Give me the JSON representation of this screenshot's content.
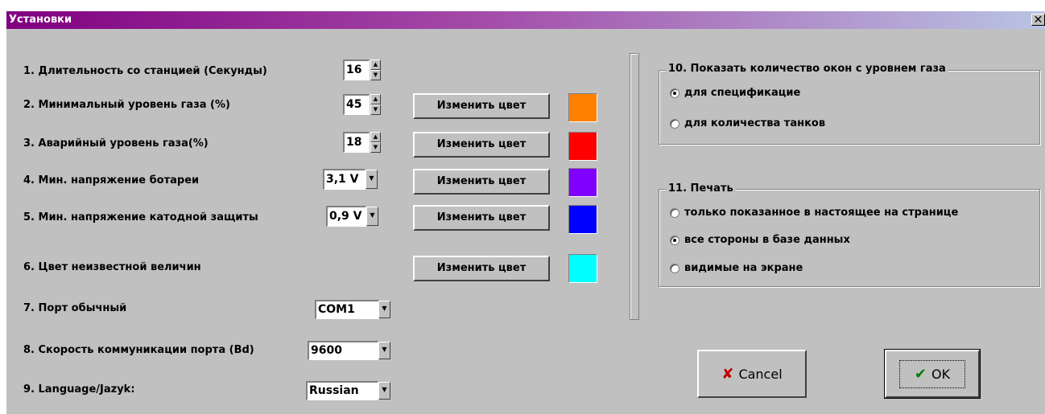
{
  "window": {
    "title": "Установки",
    "close_label": "✕"
  },
  "settings": {
    "duration_label": "1. Длительность со станцией (Секунды)",
    "duration_value": "16",
    "min_gas_label": "2. Минимальный уровень газа (%)",
    "min_gas_value": "45",
    "alarm_gas_label": "3. Аварийный уровень газа(%)",
    "alarm_gas_value": "18",
    "min_battery_label": "4. Мин. напряжение ботареи",
    "min_battery_value": "3,1 V",
    "min_cathodic_label": "5. Мин. напряжение катодной защиты",
    "min_cathodic_value": "0,9 V",
    "unknown_color_label": "6. Цвет неизвестной величин",
    "port_label": "7. Порт обычный",
    "port_value": "COM1",
    "baud_label": "8. Скорость коммуникации порта (Bd)",
    "baud_value": "9600",
    "language_label": "9. Language/Jazyk:",
    "language_value": "Russian"
  },
  "change_color_label": "Изменить цвет",
  "colors": {
    "min_gas": "#ff8000",
    "alarm_gas": "#ff0000",
    "min_battery": "#8000ff",
    "min_cathodic": "#0000ff",
    "unknown": "#00ffff"
  },
  "group10": {
    "title": "10. Показать количество окон с уровнем газа",
    "options": [
      {
        "label": "для спецификацие",
        "selected": true
      },
      {
        "label": "для количества танков",
        "selected": false
      }
    ]
  },
  "group11": {
    "title": "11. Печать",
    "options": [
      {
        "label": "только показанное в настоящее на странице",
        "selected": false
      },
      {
        "label": "все стороны в базе данных",
        "selected": true
      },
      {
        "label": "видимые на экране",
        "selected": false
      }
    ]
  },
  "buttons": {
    "cancel": "Cancel",
    "ok": "OK",
    "cancel_icon": "✘",
    "ok_icon": "✔"
  }
}
